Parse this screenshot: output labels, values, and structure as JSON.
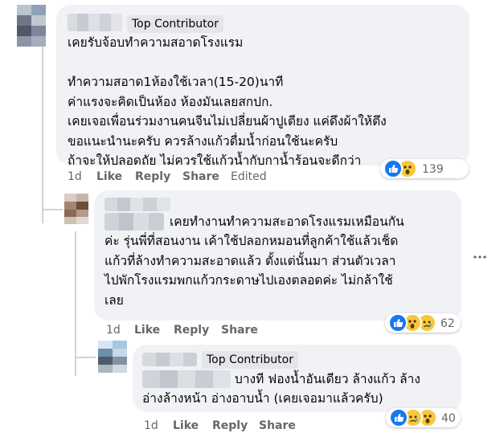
{
  "comments": [
    {
      "badge": "Top Contributor",
      "text": "เคยรับจ้อบทำความสอาดโรงแรม\n\nทำความสอาด1ห้องใช้เวลา(15-20)นาที\nค่าแรงจะคิดเป็นห้อง ห้องมันเลยสกปก.\nเคยเจอเพื่อนร่วมงานคนจีนไม่เปลี่ยนผ้าปูเตียง แค่ดึงผ้าให้ตึง\nขอแนะนำนะครับ ควรล้างแก้วดื่มน้ำก่อนใช้นะครับ\nถ้าจะให้ปลอดถัย ไม่ควรใช้แก้วน้ำกับกาน้ำร้อนจะดีกว่า",
      "time": "1d",
      "like": "Like",
      "reply": "Reply",
      "share": "Share",
      "edited": "Edited",
      "reactions": [
        "like",
        "wow"
      ],
      "reaction_count": "139"
    },
    {
      "badge": "",
      "text_first": "เคยทำงานทำความสะอาดโรงแรมเหมือนกัน",
      "text_rest": "ค่ะ รุ่นพี่ที่สอนงาน เค้าใช้ปลอกหมอนที่ลูกค้าใช้แล้วเช็ด\nแก้วที่ล้างทำความสะอาดแล้ว ตั้งแต่นั้นมา ส่วนตัวเวลา\nไปพักโรงแรมพกแก้วกระดาษไปเองตลอดค่ะ ไม่กล้าใช้\nเลย",
      "time": "1d",
      "like": "Like",
      "reply": "Reply",
      "share": "Share",
      "reactions": [
        "like",
        "wow",
        "sad"
      ],
      "reaction_count": "62",
      "more_icon": "more-dots-icon"
    },
    {
      "badge": "Top Contributor",
      "text_first": "บางที ฟองน้ำอันเดียว ล้างแก้ว ล้าง",
      "text_rest": "อ่างล้างหน้า อ่างอาบน้ำ (เคยเจอมาแล้วครับ)",
      "time": "1d",
      "like": "Like",
      "reply": "Reply",
      "share": "Share",
      "reactions": [
        "like",
        "sad",
        "wow"
      ],
      "reaction_count": "40"
    }
  ],
  "colors": {
    "bubble": "#f0f2f5",
    "meta": "#65676b",
    "like_blue": "#1877f2",
    "emoji_yellow": "#f7c83f"
  }
}
